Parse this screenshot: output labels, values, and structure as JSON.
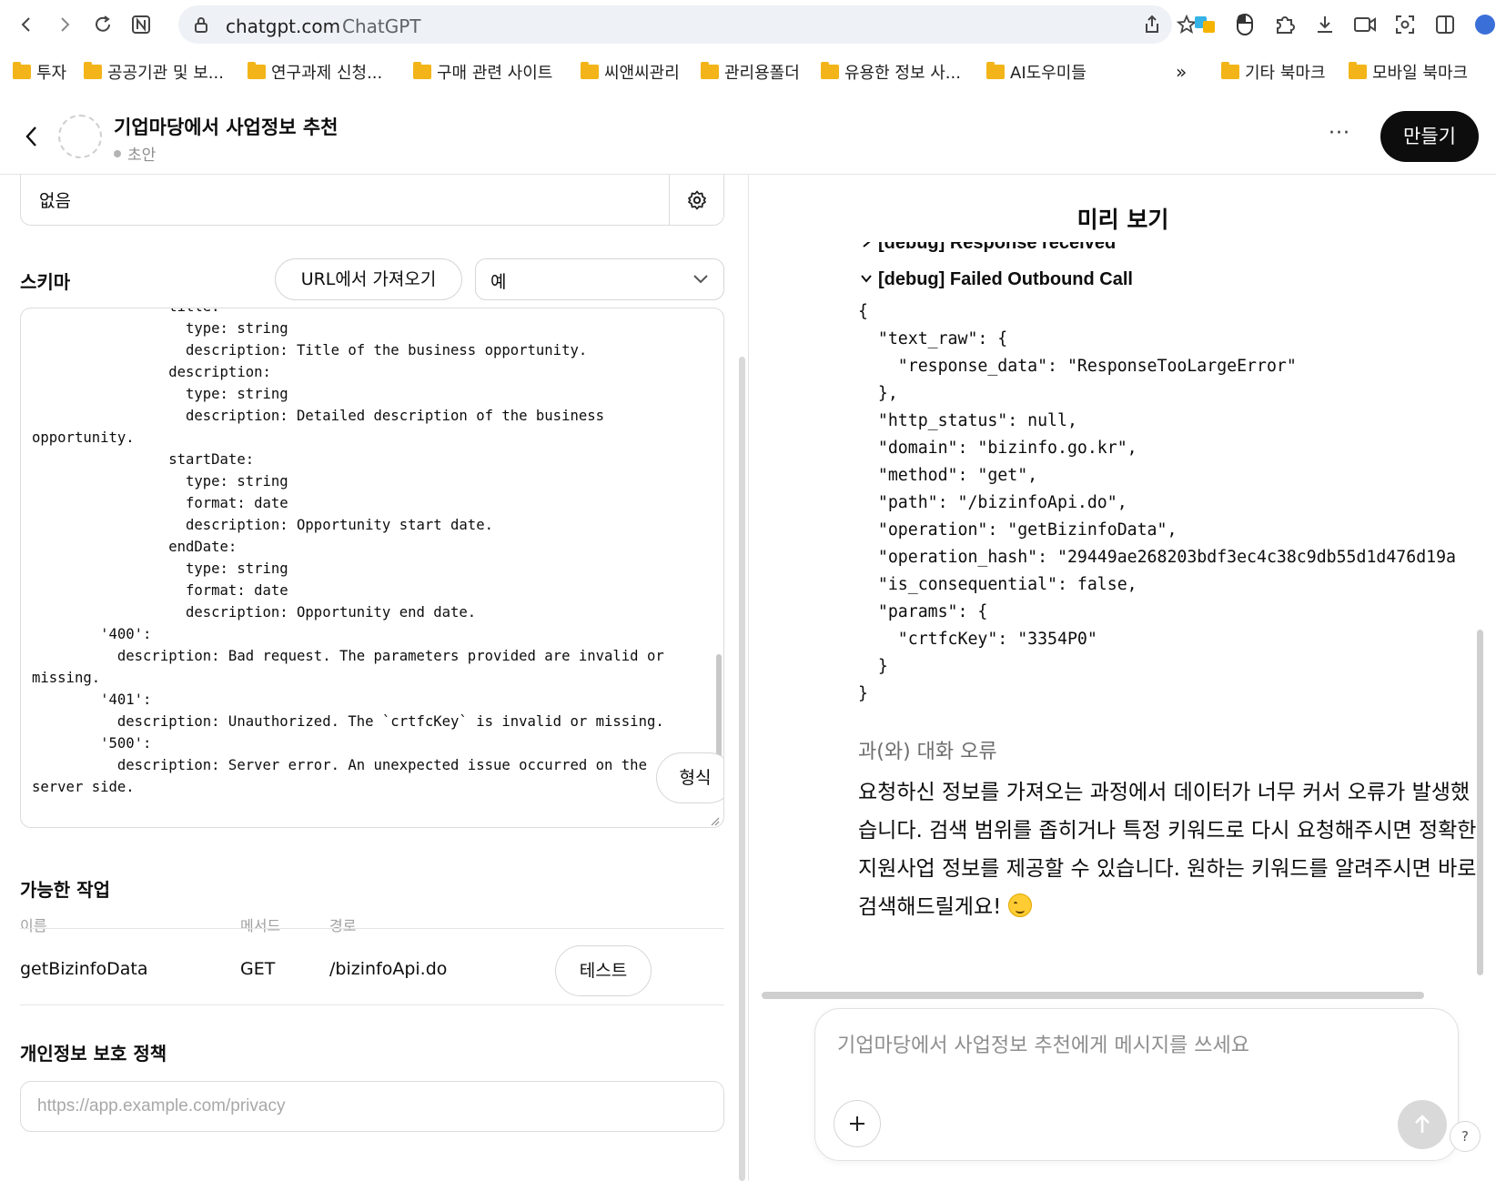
{
  "browser": {
    "url_host": "chatgpt.com",
    "page_title": "ChatGPT",
    "bookmarks": [
      "투자",
      "공공기관 및 보...",
      "연구과제 신청...",
      "구매 관련 사이트",
      "씨앤씨관리",
      "관리용폴더",
      "유용한 정보 사...",
      "AI도우미들"
    ],
    "overflow": "»",
    "other_bookmarks": [
      "기타 북마크",
      "모바일 북마크"
    ]
  },
  "header": {
    "title": "기업마당에서 사업정보 추천",
    "status": "초안",
    "more": "···",
    "create_label": "만들기"
  },
  "config": {
    "auth_value": "없음",
    "schema_label": "스키마",
    "import_button": "URL에서 가져오기",
    "example_selected": "예",
    "schema_text": "                title:\n                  type: string\n                  description: Title of the business opportunity.\n                description:\n                  type: string\n                  description: Detailed description of the business\nopportunity.\n                startDate:\n                  type: string\n                  format: date\n                  description: Opportunity start date.\n                endDate:\n                  type: string\n                  format: date\n                  description: Opportunity end date.\n        '400':\n          description: Bad request. The parameters provided are invalid or\nmissing.\n        '401':\n          description: Unauthorized. The `crtfcKey` is invalid or missing.\n        '500':\n          description: Server error. An unexpected issue occurred on the\nserver side.",
    "format_button": "형식",
    "ops_label": "가능한 작업",
    "ops_columns": [
      "이름",
      "메서드",
      "경로"
    ],
    "ops_rows": [
      {
        "name": "getBizinfoData",
        "method": "GET",
        "path": "/bizinfoApi.do",
        "action": "테스트"
      }
    ],
    "privacy_label": "개인정보 보호 정책",
    "privacy_placeholder": "https://app.example.com/privacy"
  },
  "preview": {
    "title": "미리 보기",
    "debug_response": "[debug] Response received",
    "debug_failed": "[debug] Failed Outbound Call",
    "json_text": "{\n  \"text_raw\": {\n    \"response_data\": \"ResponseTooLargeError\"\n  },\n  \"http_status\": null,\n  \"domain\": \"bizinfo.go.kr\",\n  \"method\": \"get\",\n  \"path\": \"/bizinfoApi.do\",\n  \"operation\": \"getBizinfoData\",\n  \"operation_hash\": \"29449ae268203bdf3ec4c38c9db55d1d476d19a\n  \"is_consequential\": false,\n  \"params\": {\n    \"crtfcKey\": \"3354P0\"\n  }\n}",
    "error_label": "과(와) 대화 오류",
    "assistant_message": "요청하신 정보를 가져오는 과정에서 데이터가 너무 커서 오류가 발생했습니다. 검색 범위를 좁히거나 특정 키워드로 다시 요청해주시면 정확한 지원사업 정보를 제공할 수 있습니다. 원하는 키워드를 알려주시면 바로 검색해드릴게요!",
    "composer_placeholder": "기업마당에서 사업정보 추천에게 메시지를 쓰세요",
    "help": "?"
  },
  "colors": {
    "accent": "#0d0d0d",
    "folder": "#f2b418"
  }
}
